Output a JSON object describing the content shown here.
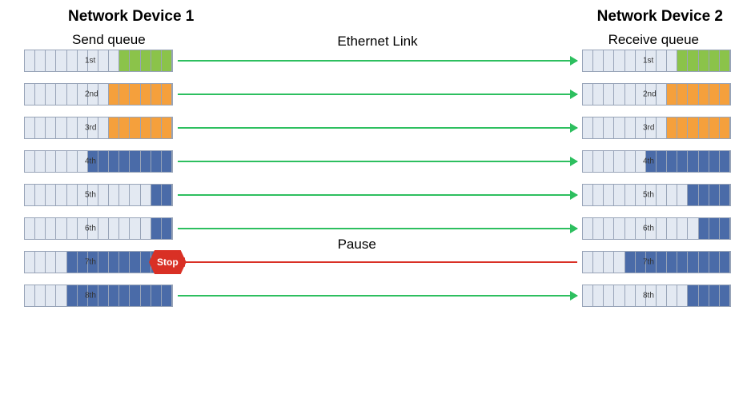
{
  "title_left": "Network Device 1",
  "title_right": "Network Device 2",
  "sub_left": "Send queue",
  "sub_right": "Receive queue",
  "link_label": "Ethernet Link",
  "pause_label": "Pause",
  "stop_label": "Stop",
  "queues": [
    {
      "label": "1st",
      "fill_start": 10,
      "color": "green",
      "pause": false
    },
    {
      "label": "2nd",
      "fill_start": 9,
      "color": "orange",
      "pause": false
    },
    {
      "label": "3rd",
      "fill_start": 9,
      "color": "orange",
      "pause": false
    },
    {
      "label": "4th",
      "fill_start": 7,
      "color": "blue",
      "pause": false
    },
    {
      "label": "5th",
      "fill_start": 13,
      "color": "blue",
      "pause": false
    },
    {
      "label": "6th",
      "fill_start": 13,
      "color": "blue",
      "pause": false
    },
    {
      "label": "7th",
      "fill_start": 5,
      "color": "blue",
      "pause": true
    },
    {
      "label": "8th",
      "fill_start": 5,
      "color": "blue",
      "pause": false
    }
  ],
  "receive_queues": [
    {
      "label": "1st",
      "fill_start": 10,
      "color": "green"
    },
    {
      "label": "2nd",
      "fill_start": 9,
      "color": "orange"
    },
    {
      "label": "3rd",
      "fill_start": 9,
      "color": "orange"
    },
    {
      "label": "4th",
      "fill_start": 7,
      "color": "blue"
    },
    {
      "label": "5th",
      "fill_start": 11,
      "color": "blue"
    },
    {
      "label": "6th",
      "fill_start": 12,
      "color": "blue"
    },
    {
      "label": "7th",
      "fill_start": 5,
      "color": "blue"
    },
    {
      "label": "8th",
      "fill_start": 11,
      "color": "blue"
    }
  ],
  "cells_per_queue": 14
}
